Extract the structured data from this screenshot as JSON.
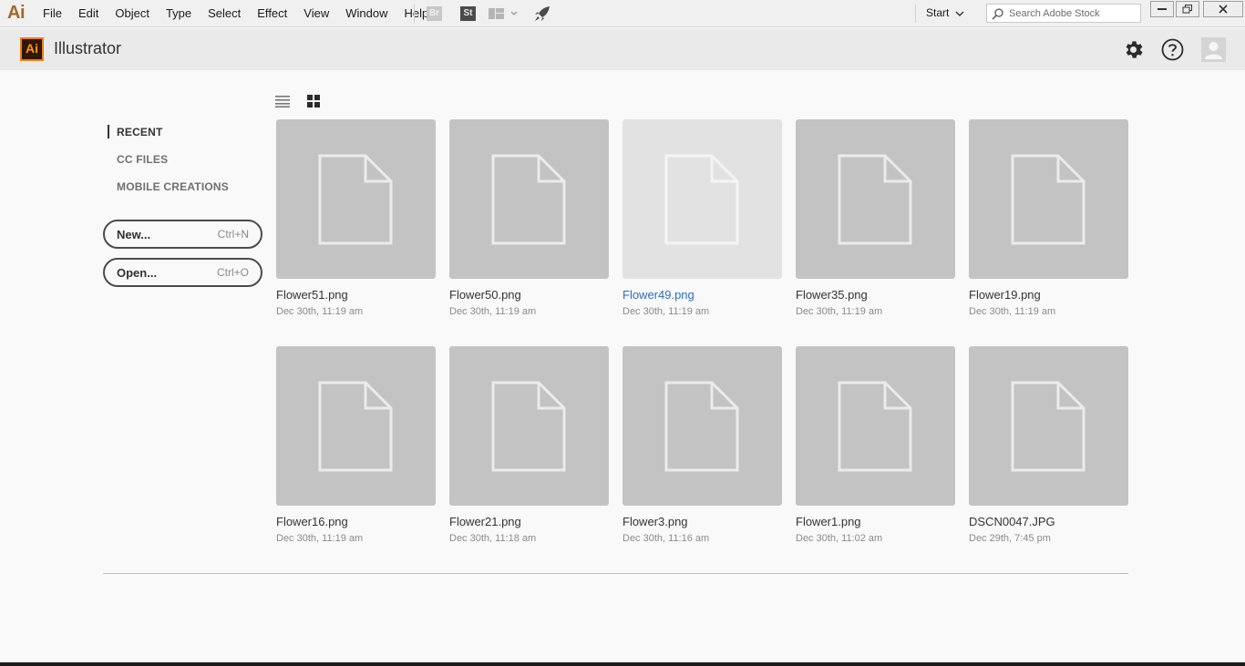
{
  "menubar": {
    "app_mark": "Ai",
    "menus": [
      "File",
      "Edit",
      "Object",
      "Type",
      "Select",
      "Effect",
      "View",
      "Window",
      "Help"
    ],
    "bridge_label": "Br",
    "stock_label": "St",
    "workspace": "Start",
    "search_placeholder": "Search Adobe Stock"
  },
  "header": {
    "logo": "Ai",
    "title": "Illustrator"
  },
  "sidebar": {
    "nav": [
      "RECENT",
      "CC FILES",
      "MOBILE CREATIONS"
    ],
    "active": "RECENT",
    "new_label": "New...",
    "new_shortcut": "Ctrl+N",
    "open_label": "Open...",
    "open_shortcut": "Ctrl+O"
  },
  "files": [
    {
      "name": "Flower51.png",
      "date": "Dec 30th, 11:19 am"
    },
    {
      "name": "Flower50.png",
      "date": "Dec 30th, 11:19 am"
    },
    {
      "name": "Flower49.png",
      "date": "Dec 30th, 11:19 am"
    },
    {
      "name": "Flower35.png",
      "date": "Dec 30th, 11:19 am"
    },
    {
      "name": "Flower19.png",
      "date": "Dec 30th, 11:19 am"
    },
    {
      "name": "Flower16.png",
      "date": "Dec 30th, 11:19 am"
    },
    {
      "name": "Flower21.png",
      "date": "Dec 30th, 11:18 am"
    },
    {
      "name": "Flower3.png",
      "date": "Dec 30th, 11:16 am"
    },
    {
      "name": "Flower1.png",
      "date": "Dec 30th, 11:02 am"
    },
    {
      "name": "DSCN0047.JPG",
      "date": "Dec 29th, 7:45 pm"
    }
  ],
  "colors": {
    "thumb_bg": "#c3c3c3",
    "thumb_hover_bg": "#e2e2e2",
    "hover_link": "#2d6cbf",
    "logo_orange": "#ff9a00",
    "logo_bg": "#2f1708"
  },
  "icons": [
    "gear-icon",
    "help-icon",
    "user-icon",
    "list-view-icon",
    "grid-view-icon",
    "document-icon",
    "search-icon",
    "rocket-icon",
    "workspace-icon"
  ]
}
